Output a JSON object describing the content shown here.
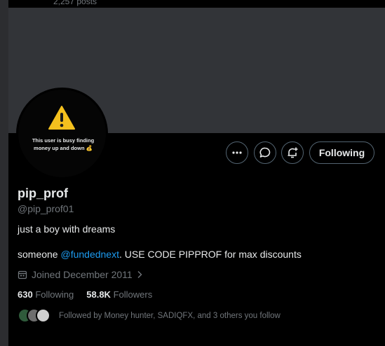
{
  "header": {
    "posts_count": "2,257 posts"
  },
  "avatar": {
    "message": "This user is busy finding money up and down 💰"
  },
  "actions": {
    "follow_label": "Following"
  },
  "profile": {
    "name": "pip_prof",
    "handle": "@pip_prof01",
    "bio_line1": "just a boy with dreams",
    "bio_prefix": "someone ",
    "bio_mention": "@fundednext",
    "bio_suffix": ". USE CODE PIPPROF for max discounts",
    "joined": "Joined December 2011"
  },
  "stats": {
    "following_count": "630",
    "following_label": "Following",
    "followers_count": "58.8K",
    "followers_label": "Followers"
  },
  "followed_by": {
    "text": "Followed by Money hunter, SADIQFX, and 3 others you follow"
  },
  "colors": {
    "accent": "#1d9bf0",
    "muted": "#71767b",
    "banner": "#323438"
  }
}
